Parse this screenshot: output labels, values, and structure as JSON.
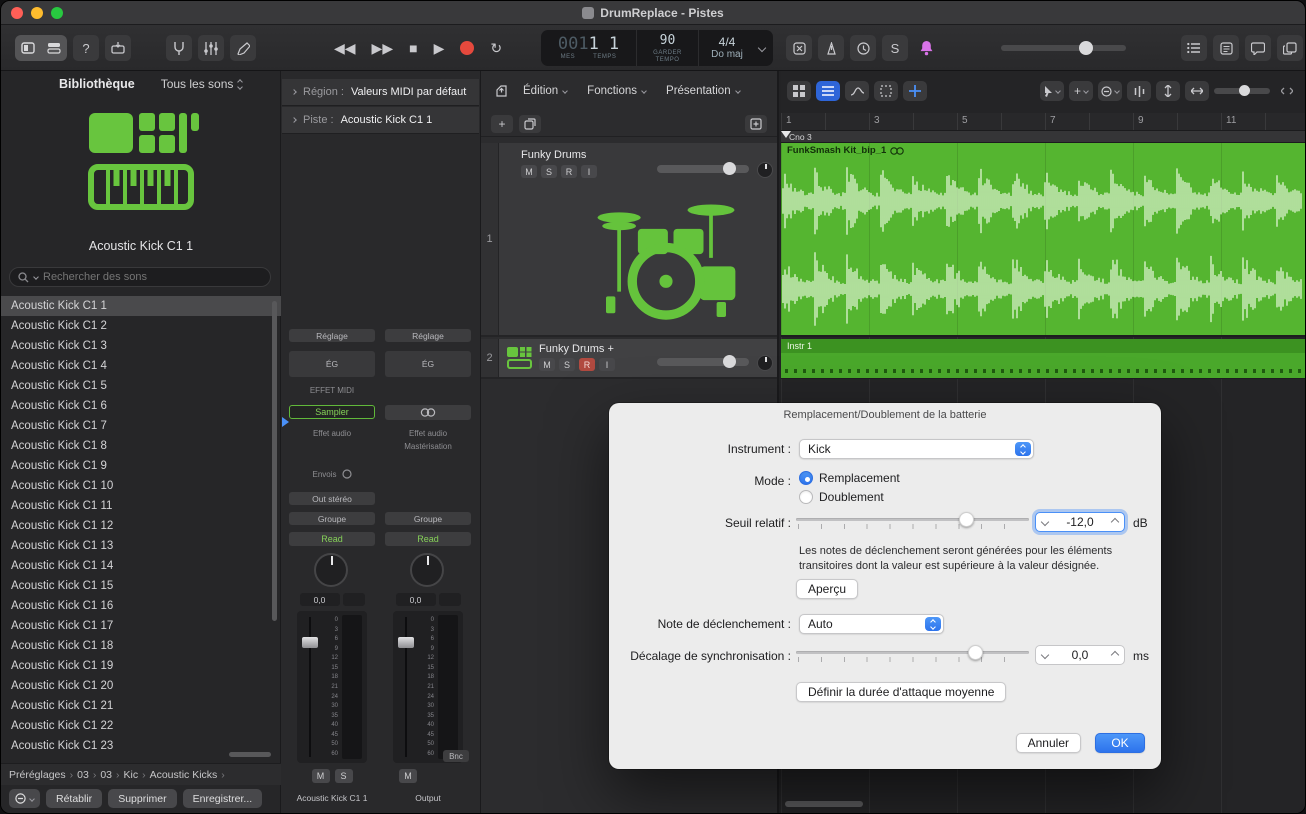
{
  "window": {
    "title": "DrumReplace - Pistes"
  },
  "control_bar": {
    "help_label": "?",
    "lcd": {
      "mes_dim": "001",
      "mes_bright": "1",
      "temps": "1",
      "mes_label": "MES",
      "temps_label": "TEMPS",
      "tempo": "90",
      "tempo_line1": "GARDER",
      "tempo_line2": "TEMPO",
      "signature": "4/4",
      "key": "Do maj"
    },
    "solo_label": "S"
  },
  "library": {
    "title": "Bibliothèque",
    "filter_label": "Tous les sons",
    "patch_name": "Acoustic Kick C1 1",
    "search_placeholder": "Rechercher des sons",
    "items": [
      "Acoustic Kick C1 1",
      "Acoustic Kick C1 2",
      "Acoustic Kick C1 3",
      "Acoustic Kick C1 4",
      "Acoustic Kick C1 5",
      "Acoustic Kick C1 6",
      "Acoustic Kick C1 7",
      "Acoustic Kick C1 8",
      "Acoustic Kick C1 9",
      "Acoustic Kick C1 10",
      "Acoustic Kick C1 11",
      "Acoustic Kick C1 12",
      "Acoustic Kick C1 13",
      "Acoustic Kick C1 14",
      "Acoustic Kick C1 15",
      "Acoustic Kick C1 16",
      "Acoustic Kick C1 17",
      "Acoustic Kick C1 18",
      "Acoustic Kick C1 19",
      "Acoustic Kick C1 20",
      "Acoustic Kick C1 21",
      "Acoustic Kick C1 22",
      "Acoustic Kick C1 23"
    ],
    "selected_item": "Acoustic Kick C1 1",
    "breadcrumb": [
      "Préréglages",
      "03",
      "03",
      "Kic",
      "Acoustic Kicks"
    ],
    "revert_button": "Rétablir",
    "delete_button": "Supprimer",
    "save_button": "Enregistrer..."
  },
  "inspector": {
    "region_label": "Région :",
    "region_value": "Valeurs MIDI par défaut",
    "track_label": "Piste :",
    "track_value": "Acoustic Kick C1 1",
    "fader_scale": [
      "0",
      "3",
      "6",
      "9",
      "12",
      "15",
      "18",
      "21",
      "24",
      "30",
      "35",
      "40",
      "45",
      "50",
      "60"
    ],
    "strip1": {
      "setting": "Réglage",
      "eq": "ÉG",
      "midi_fx": "EFFET MIDI",
      "instrument": "Sampler",
      "audio_fx": "Effet audio",
      "sends": "Envois",
      "output": "Out stéréo",
      "group": "Groupe",
      "automation": "Read",
      "pan": "0,0",
      "mute": "M",
      "solo": "S",
      "name": "Acoustic Kick C1 1"
    },
    "strip2": {
      "setting": "Réglage",
      "eq": "ÉG",
      "audio_fx": "Effet audio",
      "mastering": "Mastérisation",
      "group": "Groupe",
      "automation": "Read",
      "pan": "0,0",
      "bounce": "Bnc",
      "mute": "M",
      "name": "Output"
    }
  },
  "track_header": {
    "menus": [
      "Édition",
      "Fonctions",
      "Présentation"
    ],
    "tracks": [
      {
        "number": "1",
        "name": "Funky Drums",
        "mute": "M",
        "solo": "S",
        "record": "R",
        "input": "I"
      },
      {
        "number": "2",
        "name": "Funky Drums +",
        "mute": "M",
        "solo": "S",
        "record": "R",
        "input": "I"
      }
    ]
  },
  "arrange": {
    "ruler_ticks": [
      "1",
      "3",
      "5",
      "7",
      "9",
      "11"
    ],
    "marker_name": "Cno 3",
    "audio_region_name": "FunkSmash Kit_bip_1",
    "midi_region_name": "Instr 1"
  },
  "dialog": {
    "title": "Remplacement/Doublement de la batterie",
    "instrument_label": "Instrument :",
    "instrument_value": "Kick",
    "mode_label": "Mode :",
    "mode_replace": "Remplacement",
    "mode_double": "Doublement",
    "threshold_label": "Seuil relatif :",
    "threshold_value": "-12,0",
    "threshold_unit": "dB",
    "help_text": "Les notes de déclenchement seront générées pour les éléments transitoires dont la valeur est supérieure à la valeur désignée.",
    "preview_button": "Aperçu",
    "trigger_label": "Note de déclenchement :",
    "trigger_value": "Auto",
    "offset_label": "Décalage de synchronisation :",
    "offset_value": "0,0",
    "offset_unit": "ms",
    "attack_button": "Définir la durée d'attaque moyenne",
    "cancel_button": "Annuler",
    "ok_button": "OK"
  },
  "colors": {
    "accent_green": "#65c23c",
    "region_green": "#55b530",
    "accent_blue": "#2e7cf6",
    "record_red": "#e5493d",
    "bell_pink": "#d873e8"
  }
}
